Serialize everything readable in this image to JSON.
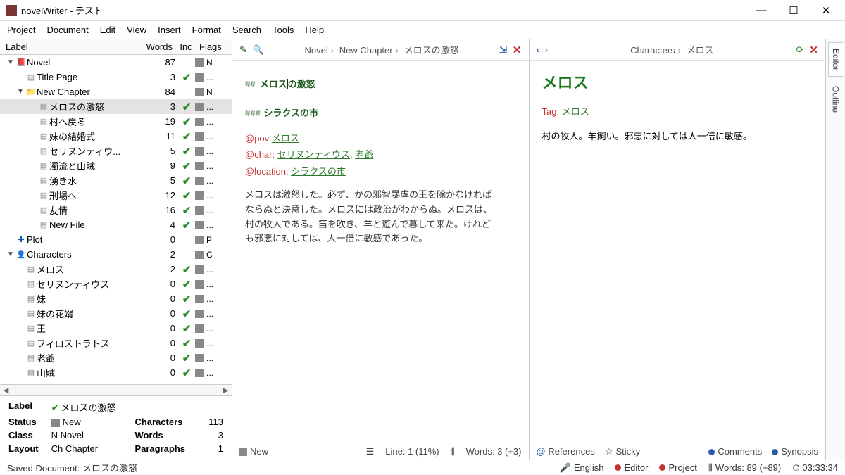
{
  "window": {
    "title": "novelWriter - テスト"
  },
  "menu": {
    "project": "Project",
    "document": "Document",
    "edit": "Edit",
    "view": "View",
    "insert": "Insert",
    "format": "Format",
    "search": "Search",
    "tools": "Tools",
    "help": "Help"
  },
  "tree": {
    "headers": {
      "label": "Label",
      "words": "Words",
      "inc": "Inc",
      "flags": "Flags"
    },
    "rows": [
      {
        "indent": 1,
        "exp": "▼",
        "icon": "book",
        "label": "Novel",
        "words": "87",
        "inc": "",
        "flag": "N"
      },
      {
        "indent": 2,
        "exp": "",
        "icon": "doc",
        "label": "Title Page",
        "words": "3",
        "inc": "✔",
        "flag": "..."
      },
      {
        "indent": 2,
        "exp": "▼",
        "icon": "folder",
        "label": "New Chapter",
        "words": "84",
        "inc": "",
        "flag": "N"
      },
      {
        "indent": 3,
        "exp": "",
        "icon": "doc",
        "label": "メロスの激怒",
        "words": "3",
        "inc": "✔",
        "flag": "...",
        "sel": true
      },
      {
        "indent": 3,
        "exp": "",
        "icon": "doc",
        "label": "村へ戻る",
        "words": "19",
        "inc": "✔",
        "flag": "..."
      },
      {
        "indent": 3,
        "exp": "",
        "icon": "doc",
        "label": "妹の結婚式",
        "words": "11",
        "inc": "✔",
        "flag": "..."
      },
      {
        "indent": 3,
        "exp": "",
        "icon": "doc",
        "label": "セリヌンティウ...",
        "words": "5",
        "inc": "✔",
        "flag": "..."
      },
      {
        "indent": 3,
        "exp": "",
        "icon": "doc",
        "label": "濁流と山賊",
        "words": "9",
        "inc": "✔",
        "flag": "..."
      },
      {
        "indent": 3,
        "exp": "",
        "icon": "doc",
        "label": "湧き水",
        "words": "5",
        "inc": "✔",
        "flag": "..."
      },
      {
        "indent": 3,
        "exp": "",
        "icon": "doc",
        "label": "刑場へ",
        "words": "12",
        "inc": "✔",
        "flag": "..."
      },
      {
        "indent": 3,
        "exp": "",
        "icon": "doc",
        "label": "友情",
        "words": "16",
        "inc": "✔",
        "flag": "..."
      },
      {
        "indent": 3,
        "exp": "",
        "icon": "doc",
        "label": "New File",
        "words": "4",
        "inc": "✔",
        "flag": "..."
      },
      {
        "indent": 1,
        "exp": "",
        "icon": "plot",
        "label": "Plot",
        "words": "0",
        "inc": "",
        "flag": "P"
      },
      {
        "indent": 1,
        "exp": "▼",
        "icon": "char",
        "label": "Characters",
        "words": "2",
        "inc": "",
        "flag": "C"
      },
      {
        "indent": 2,
        "exp": "",
        "icon": "doc",
        "label": "メロス",
        "words": "2",
        "inc": "✔",
        "flag": "..."
      },
      {
        "indent": 2,
        "exp": "",
        "icon": "doc",
        "label": "セリヌンティウス",
        "words": "0",
        "inc": "✔",
        "flag": "..."
      },
      {
        "indent": 2,
        "exp": "",
        "icon": "doc",
        "label": "妹",
        "words": "0",
        "inc": "✔",
        "flag": "..."
      },
      {
        "indent": 2,
        "exp": "",
        "icon": "doc",
        "label": "妹の花婿",
        "words": "0",
        "inc": "✔",
        "flag": "..."
      },
      {
        "indent": 2,
        "exp": "",
        "icon": "doc",
        "label": "王",
        "words": "0",
        "inc": "✔",
        "flag": "..."
      },
      {
        "indent": 2,
        "exp": "",
        "icon": "doc",
        "label": "フィロストラトス",
        "words": "0",
        "inc": "✔",
        "flag": "..."
      },
      {
        "indent": 2,
        "exp": "",
        "icon": "doc",
        "label": "老爺",
        "words": "0",
        "inc": "✔",
        "flag": "..."
      },
      {
        "indent": 2,
        "exp": "",
        "icon": "doc",
        "label": "山賊",
        "words": "0",
        "inc": "✔",
        "flag": "..."
      }
    ]
  },
  "details": {
    "label_lab": "Label",
    "label_val": "メロスの激怒",
    "status_lab": "Status",
    "status_val": "New",
    "class_lab": "Class",
    "class_val": "N Novel",
    "layout_lab": "Layout",
    "layout_val": "Ch Chapter",
    "chars_lab": "Characters",
    "chars_val": "113",
    "words_lab": "Words",
    "words_val": "3",
    "paras_lab": "Paragraphs",
    "paras_val": "1"
  },
  "editor": {
    "crumbs": [
      "Novel",
      "New Chapter",
      "メロスの激怒"
    ],
    "h1_md": "##",
    "h1": "メロスの激怒",
    "h1_a": "メロス",
    "h1_b": "の激怒",
    "h2_md": "###",
    "h2": "シラクスの市",
    "pov_key": "@pov:",
    "pov_val": "メロス",
    "char_key": "@char:",
    "char_val1": "セリヌンティウス",
    "char_comma": ", ",
    "char_val2": "老爺",
    "loc_key": "@location:",
    "loc_val": "シラクスの市",
    "body": "メロスは激怒した。必ず、かの邪智暴虐の王を除かなければならぬと決意した。メロスには政治がわからぬ。メロスは、村の牧人である。笛を吹き、羊と遊んで暮して来た。けれども邪悪に対しては、人一倍に敏感であった。",
    "footer": {
      "new": "New",
      "line": "Line: 1 (11%)",
      "words": "Words: 3 (+3)"
    }
  },
  "viewer": {
    "crumbs": [
      "Characters",
      "メロス"
    ],
    "h1": "メロス",
    "tag_key": "Tag:",
    "tag_val": "メロス",
    "desc": "村の牧人。羊飼い。邪悪に対しては人一倍に敏感。",
    "footer": {
      "refs": "References",
      "sticky": "Sticky",
      "comments": "Comments",
      "synopsis": "Synopsis"
    }
  },
  "tabs": {
    "editor": "Editor",
    "outline": "Outline"
  },
  "status": {
    "saved": "Saved Document: メロスの激怒",
    "lang": "English",
    "editor": "Editor",
    "project": "Project",
    "words": "Words: 89 (+89)",
    "time": "03:33:34"
  }
}
